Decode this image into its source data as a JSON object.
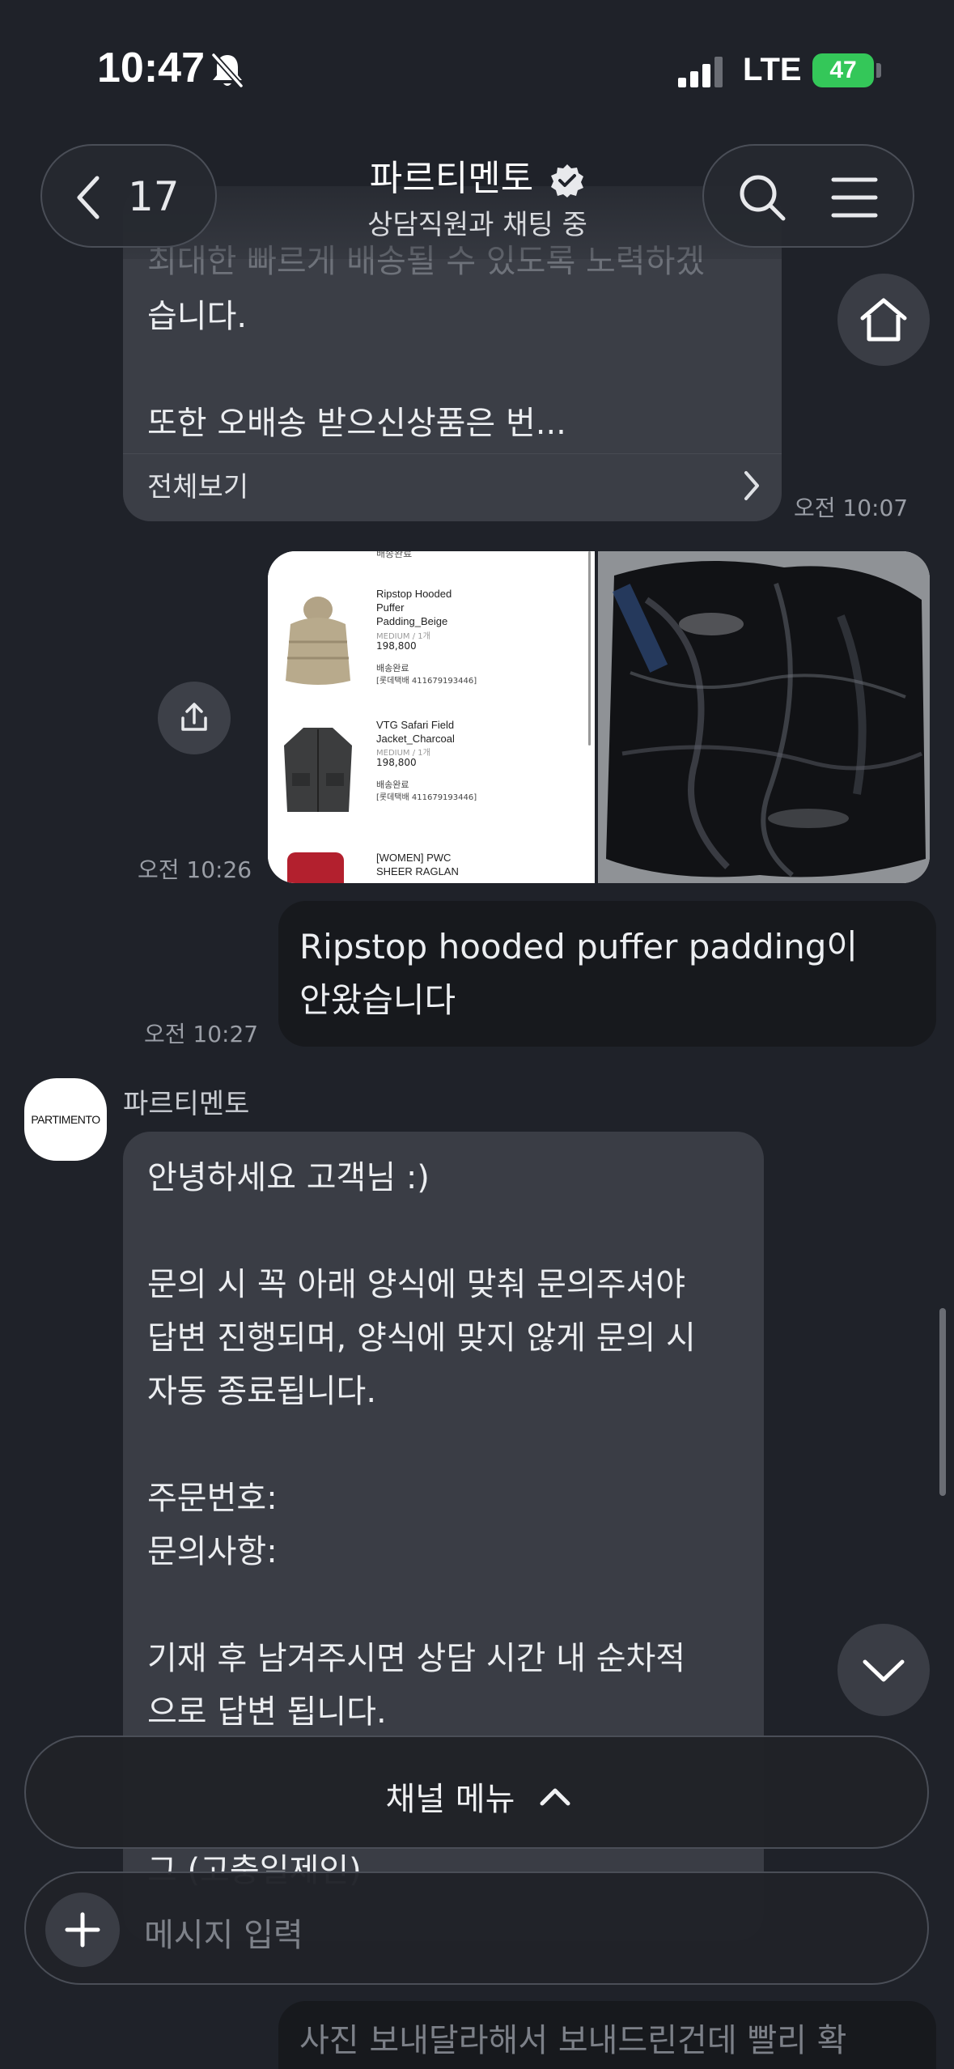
{
  "status_bar": {
    "time": "10:47",
    "network": "LTE",
    "battery": "47"
  },
  "header": {
    "back_count": "17",
    "title": "파르티멘토",
    "subtitle": "상담직원과 채팅 중"
  },
  "messages": {
    "top_faded": {
      "line1": "최대한 빠르게 배송될 수 있도록 노력하겠",
      "line2": "습니다.",
      "line3": "또한 오배송 받으신상품은 번...",
      "see_more": "전체보기",
      "time": "오전 10:07"
    },
    "image_msg": {
      "time": "오전 10:26",
      "products": [
        {
          "top_label": "배송완료"
        },
        {
          "name": "Ripstop Hooded\nPuffer\nPadding_Beige",
          "option": "MEDIUM / 1개",
          "price": "198,800",
          "status": "배송완료",
          "tracking": "[롯데택배 411679193446]"
        },
        {
          "name": "VTG Safari Field\nJacket_Charcoal",
          "option": "MEDIUM / 1개",
          "price": "198,800",
          "status": "배송완료",
          "tracking": "[롯데택배 411679193446]"
        },
        {
          "name": "[WOMEN] PWC\nSHEER RAGLAN"
        }
      ]
    },
    "out_msg": {
      "text": "Ripstop hooded puffer padding이\n안왔습니다",
      "time": "오전 10:27"
    },
    "agent_msg": {
      "sender": "파르티멘토",
      "avatar_text": "PARTIMENTO",
      "text": "안녕하세요 고객님 :)\n\n문의 시 꼭 아래 양식에 맞춰 문의주셔야\n답변 진행되며, 양식에 맞지 않게 문의 시\n자동 종료됩니다.\n\n주문번호:\n문의사항:\n\n기재 후 남겨주시면 상담 시간 내 순차적\n으로 답변 됩니다.",
      "cut_line": "그 (고충일제인)"
    },
    "bottom_faded": "사진 보내달라해서 보내드린건데 빨리 확"
  },
  "channel_menu": {
    "label": "채널 메뉴"
  },
  "composer": {
    "placeholder": "메시지 입력"
  },
  "colors": {
    "background": "#1f2229",
    "incoming_bubble": "#3a3d45",
    "outgoing_bubble": "#17191d",
    "battery": "#34c759"
  },
  "icons": {
    "back": "chevron-left-icon",
    "verified": "verified-badge-icon",
    "search": "search-icon",
    "menu": "hamburger-icon",
    "home": "home-icon",
    "share": "share-icon",
    "scroll_down": "chevron-down-icon",
    "chevron_up": "chevron-up-icon",
    "plus": "plus-icon"
  }
}
